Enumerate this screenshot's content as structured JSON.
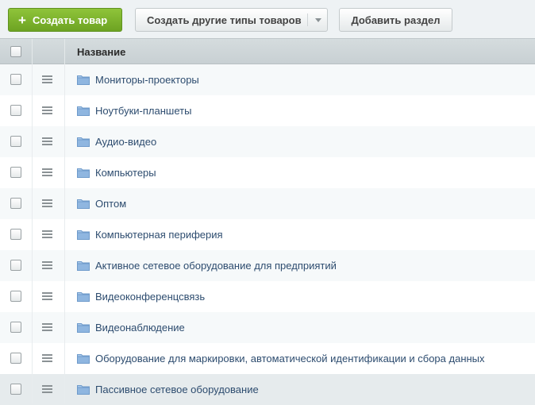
{
  "toolbar": {
    "create_product": "Создать товар",
    "create_other": "Создать другие типы товаров",
    "add_section": "Добавить раздел"
  },
  "table": {
    "header_name": "Название",
    "rows": [
      "Мониторы-проекторы",
      "Ноутбуки-планшеты",
      "Аудио-видео",
      "Компьютеры",
      "Оптом",
      "Компьютерная периферия",
      "Активное сетевое оборудование для предприятий",
      "Видеоконференцсвязь",
      "Видеонаблюдение",
      "Оборудование для маркировки, автоматической идентификации и сбора данных",
      "Пассивное сетевое оборудование"
    ]
  },
  "colors": {
    "accent_green": "#7ab32e",
    "link_text": "#2d4c6f",
    "folder": "#8fb6e0"
  },
  "icons": {
    "plus": "plus-icon",
    "caret": "chevron-down-icon",
    "drag": "drag-handle-icon",
    "folder": "folder-icon"
  }
}
